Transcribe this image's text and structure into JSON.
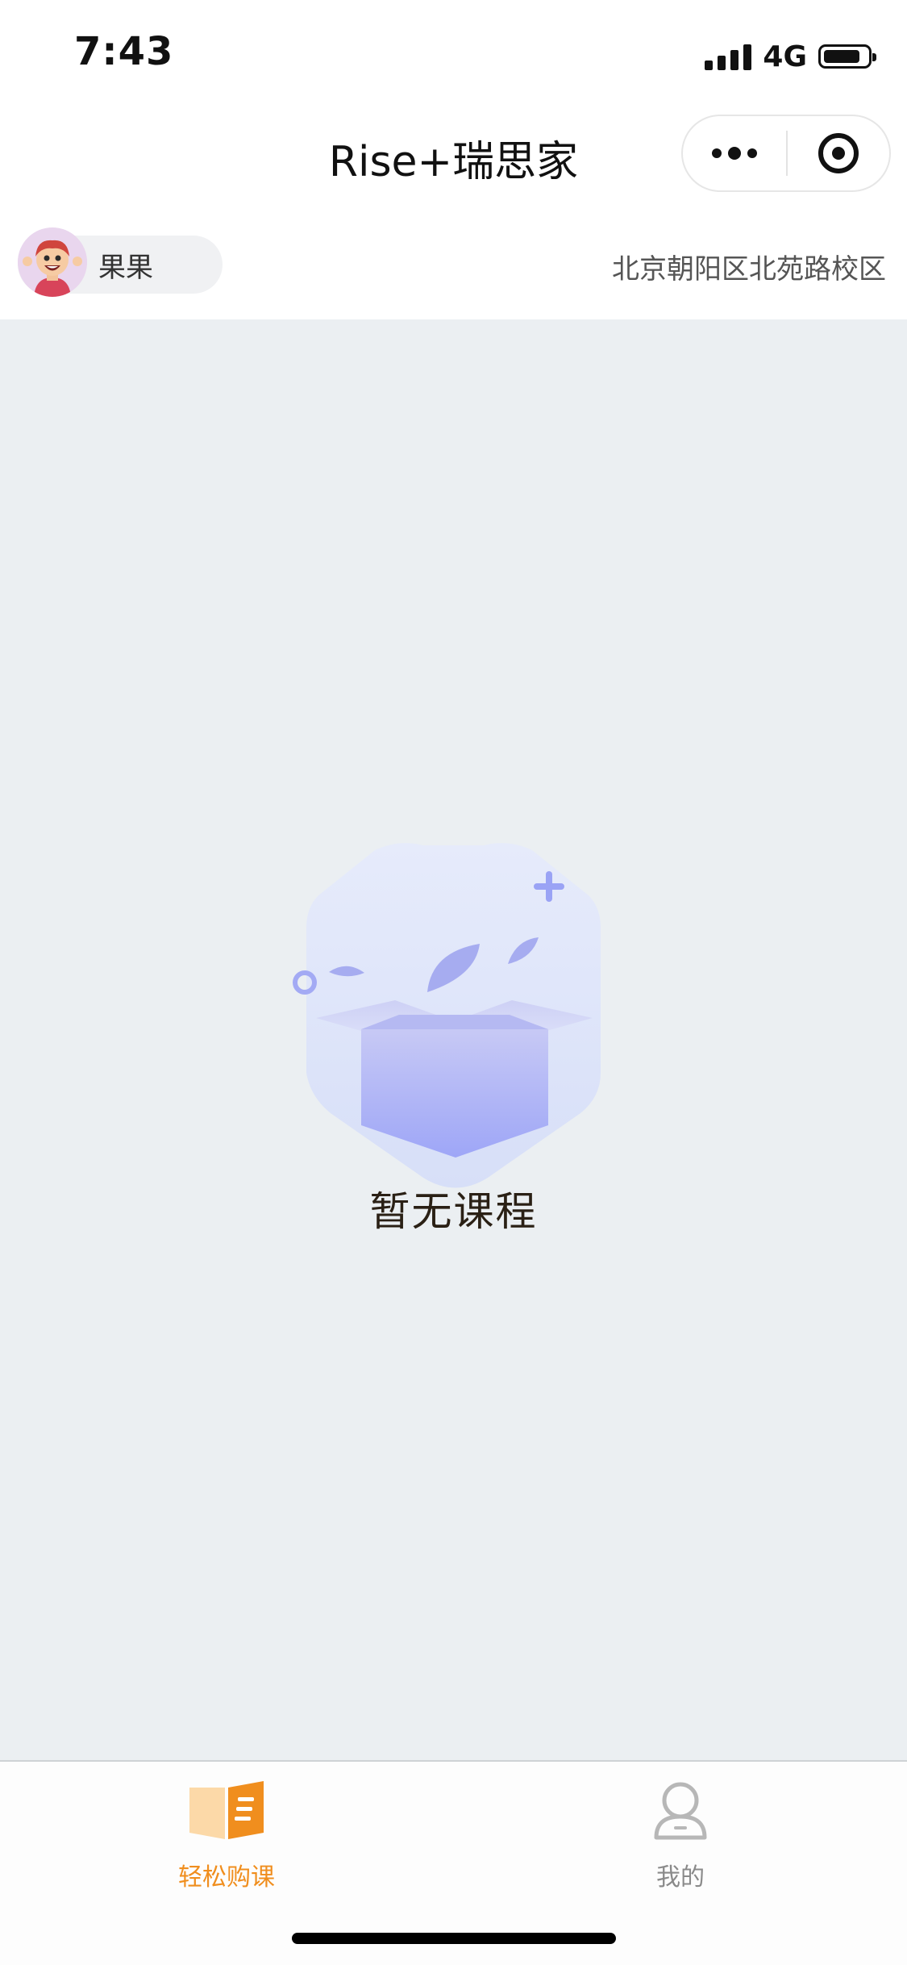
{
  "status_bar": {
    "time": "7:43",
    "network": "4G",
    "icons": [
      "signal-icon",
      "battery-icon"
    ]
  },
  "nav": {
    "title": "Rise+瑞思家",
    "more_icon": "more-dots-icon",
    "close_icon": "target-icon"
  },
  "profile": {
    "name": "果果",
    "campus": "北京朝阳区北苑路校区",
    "avatar_icon": "avatar-icon"
  },
  "empty_state": {
    "illustration": "empty-box-icon",
    "message": "暂无课程"
  },
  "tabs": [
    {
      "label": "轻松购课",
      "icon": "book-icon",
      "active": true
    },
    {
      "label": "我的",
      "icon": "person-icon",
      "active": false
    }
  ],
  "colors": {
    "accent": "#f08e1e",
    "background": "#ebeff2",
    "illustration": "#9aa3f5"
  }
}
